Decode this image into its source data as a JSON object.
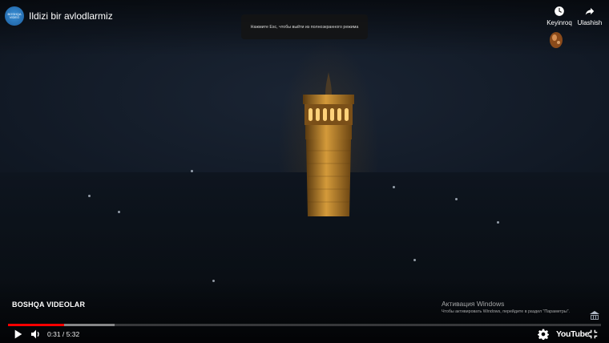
{
  "player": {
    "channel_avatar_text": "BOSHQA VIDEO",
    "video_title": "Ildizi bir avlodlarmiz",
    "fullscreen_toast": "Нажмите Esc, чтобы выйти из полноэкранного режима",
    "watch_later_label": "Keyinroq",
    "share_label": "Ulashish",
    "more_videos_label": "BOSHQA VIDEOLAR",
    "current_time": "0:31",
    "duration": "5:32",
    "time_separator": " / ",
    "progress_fraction": 0.094,
    "buffer_fraction": 0.18,
    "brand_label": "YouTube",
    "accent_color": "#ff0000"
  },
  "windows_activation": {
    "title": "Активация Windows",
    "subtitle": "Чтобы активировать Windows, перейдите в раздел \"Параметры\"."
  },
  "icons": {
    "play": "play-icon",
    "volume": "volume-icon",
    "settings": "gear-icon",
    "exit_fullscreen": "exit-fullscreen-icon",
    "watch_later": "clock-icon",
    "share": "share-arrow-icon"
  }
}
